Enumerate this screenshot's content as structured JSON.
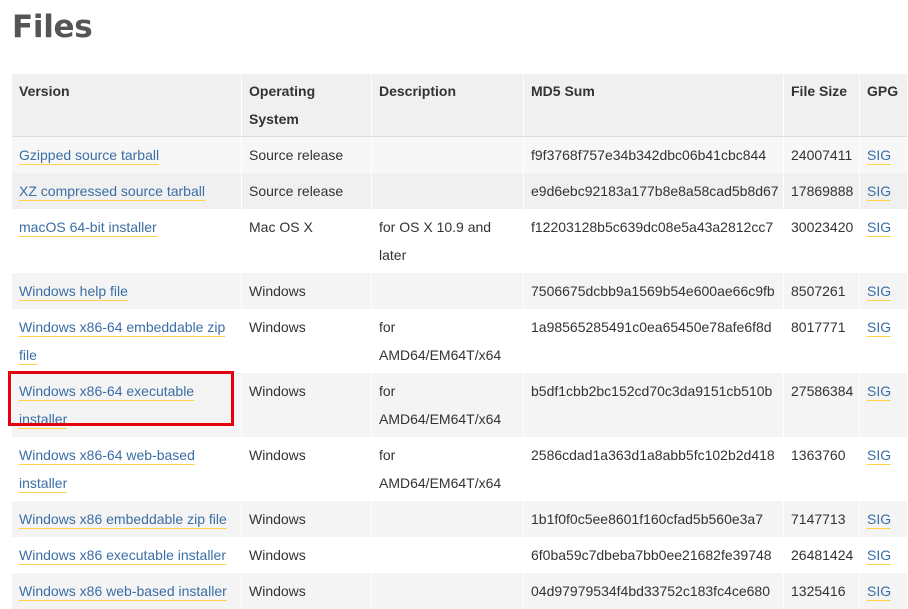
{
  "page": {
    "title": "Files"
  },
  "table": {
    "headers": {
      "version": "Version",
      "os": "Operating System",
      "description": "Description",
      "md5": "MD5 Sum",
      "size": "File Size",
      "gpg": "GPG"
    },
    "rows": [
      {
        "version": "Gzipped source tarball",
        "os": "Source release",
        "description": "",
        "md5": "f9f3768f757e34b342dbc06b41cbc844",
        "size": "24007411",
        "gpg": "SIG"
      },
      {
        "version": "XZ compressed source tarball",
        "os": "Source release",
        "description": "",
        "md5": "e9d6ebc92183a177b8e8a58cad5b8d67",
        "size": "17869888",
        "gpg": "SIG"
      },
      {
        "version": "macOS 64-bit installer",
        "os": "Mac OS X",
        "description": "for OS X 10.9 and later",
        "md5": "f12203128b5c639dc08e5a43a2812cc7",
        "size": "30023420",
        "gpg": "SIG"
      },
      {
        "version": "Windows help file",
        "os": "Windows",
        "description": "",
        "md5": "7506675dcbb9a1569b54e600ae66c9fb",
        "size": "8507261",
        "gpg": "SIG"
      },
      {
        "version": "Windows x86-64 embeddable zip file",
        "os": "Windows",
        "description": "for AMD64/EM64T/x64",
        "md5": "1a98565285491c0ea65450e78afe6f8d",
        "size": "8017771",
        "gpg": "SIG"
      },
      {
        "version": "Windows x86-64 executable installer",
        "os": "Windows",
        "description": "for AMD64/EM64T/x64",
        "md5": "b5df1cbb2bc152cd70c3da9151cb510b",
        "size": "27586384",
        "gpg": "SIG"
      },
      {
        "version": "Windows x86-64 web-based installer",
        "os": "Windows",
        "description": "for AMD64/EM64T/x64",
        "md5": "2586cdad1a363d1a8abb5fc102b2d418",
        "size": "1363760",
        "gpg": "SIG"
      },
      {
        "version": "Windows x86 embeddable zip file",
        "os": "Windows",
        "description": "",
        "md5": "1b1f0f0c5ee8601f160cfad5b560e3a7",
        "size": "7147713",
        "gpg": "SIG"
      },
      {
        "version": "Windows x86 executable installer",
        "os": "Windows",
        "description": "",
        "md5": "6f0ba59c7dbeba7bb0ee21682fe39748",
        "size": "26481424",
        "gpg": "SIG"
      },
      {
        "version": "Windows x86 web-based installer",
        "os": "Windows",
        "description": "",
        "md5": "04d97979534f4bd33752c183fc4ce680",
        "size": "1325416",
        "gpg": "SIG"
      }
    ]
  },
  "colors": {
    "link": "#3a6ea5",
    "link_underline": "#ffd343",
    "highlight": "#e3000f",
    "header_bg": "#f0f0f0"
  }
}
